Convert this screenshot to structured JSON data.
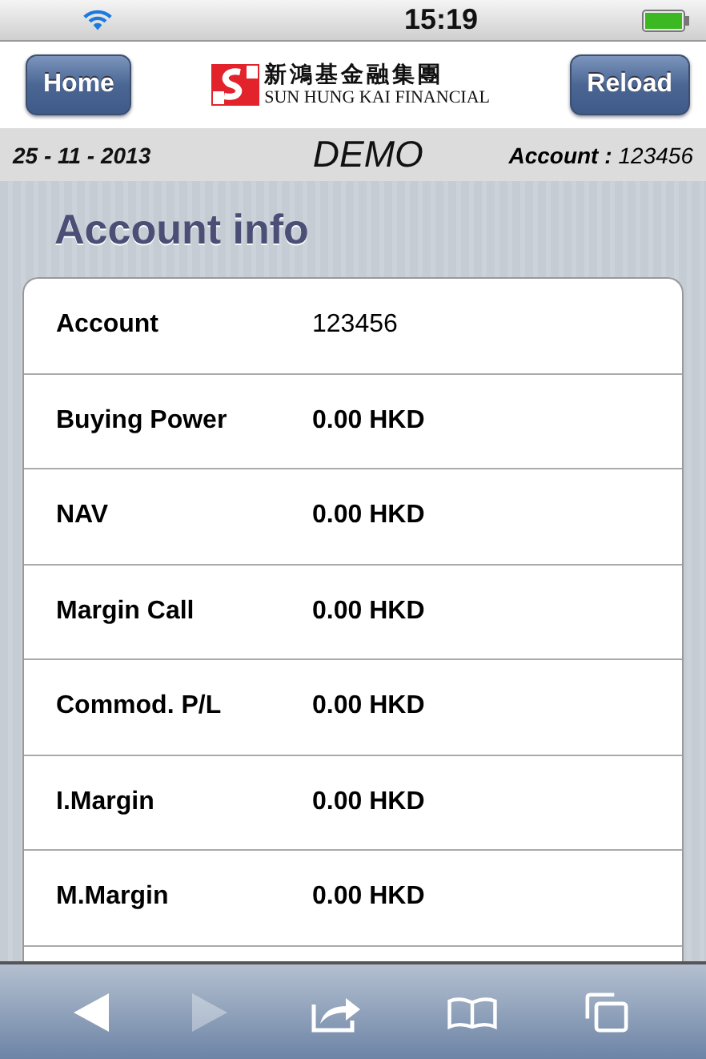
{
  "status_bar": {
    "time": "15:19"
  },
  "header": {
    "left_button": "Home",
    "right_button": "Reload",
    "logo": {
      "chinese": "新鴻基金融集團",
      "english": "SUN HUNG KAI FINANCIAL"
    }
  },
  "info_bar": {
    "date": "25 - 11 - 2013",
    "mode": "DEMO",
    "account_label": "Account :",
    "account_number": "123456"
  },
  "section_title": "Account info",
  "rows": [
    {
      "label": "Account",
      "value": "123456",
      "kind": "plain"
    },
    {
      "label": "Buying Power",
      "value": "0.00 HKD",
      "kind": "amount"
    },
    {
      "label": "NAV",
      "value": "0.00 HKD",
      "kind": "amount"
    },
    {
      "label": "Margin Call",
      "value": "0.00 HKD",
      "kind": "amount"
    },
    {
      "label": "Commod. P/L",
      "value": "0.00 HKD",
      "kind": "amount"
    },
    {
      "label": "I.Margin",
      "value": "0.00 HKD",
      "kind": "amount"
    },
    {
      "label": "M.Margin",
      "value": "0.00 HKD",
      "kind": "amount"
    }
  ],
  "toolbar": [
    {
      "kind": "back",
      "disabled": false
    },
    {
      "kind": "forward",
      "disabled": true
    },
    {
      "kind": "share",
      "disabled": false
    },
    {
      "kind": "bookmarks",
      "disabled": false
    },
    {
      "kind": "pages",
      "disabled": false
    }
  ]
}
